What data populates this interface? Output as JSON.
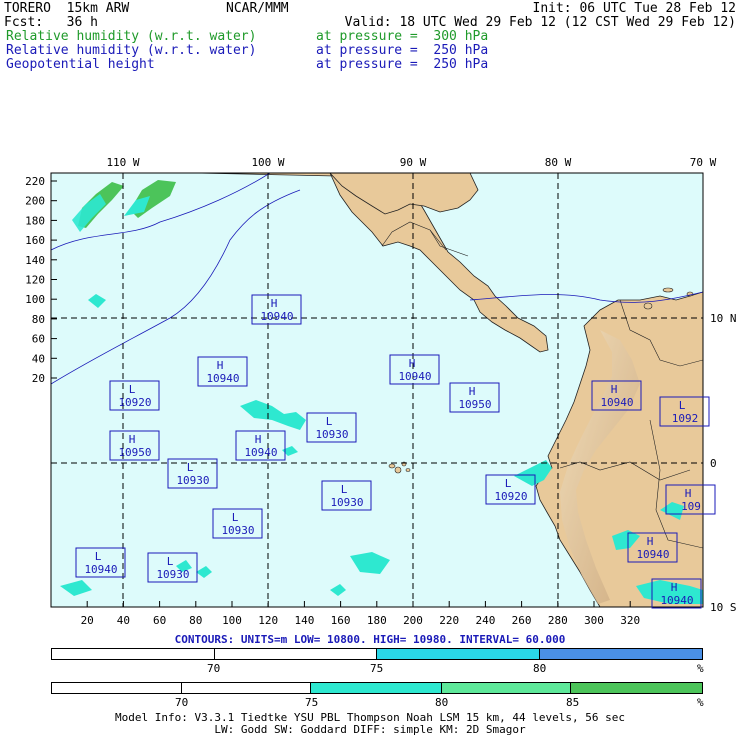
{
  "header": {
    "model": "TORERO  15km ARW",
    "center": "NCAR/MMM",
    "init": "Init: 06 UTC Tue 28 Feb 12",
    "fcst": "Fcst:   36 h",
    "valid": "Valid: 18 UTC Wed 29 Feb 12 (12 CST Wed 29 Feb 12)",
    "fields": [
      {
        "name": "Relative humidity (w.r.t. water)",
        "level": "at pressure =  300 hPa",
        "color": "#1f9a2a"
      },
      {
        "name": "Relative humidity (w.r.t. water)",
        "level": "at pressure =  250 hPa",
        "color": "#1a1ab8"
      },
      {
        "name": "Geopotential height",
        "level": "at pressure =  250 hPa",
        "color": "#1a1ab8"
      }
    ]
  },
  "map": {
    "lon_labels": [
      "110 W",
      "100 W",
      "90 W",
      "80 W",
      "70 W"
    ],
    "lat_labels": [
      "10 N",
      "0",
      "10 S"
    ],
    "x_ticks": [
      "20",
      "40",
      "60",
      "80",
      "100",
      "120",
      "140",
      "160",
      "180",
      "200",
      "220",
      "240",
      "260",
      "280",
      "300",
      "320"
    ],
    "y_ticks": [
      "220",
      "200",
      "180",
      "160",
      "140",
      "120",
      "100",
      "80",
      "60",
      "40",
      "20"
    ],
    "centers": [
      {
        "type": "H",
        "value": "10940"
      },
      {
        "type": "H",
        "value": "10940"
      },
      {
        "type": "H",
        "value": "10940"
      },
      {
        "type": "H",
        "value": "10950"
      },
      {
        "type": "H",
        "value": "10940"
      },
      {
        "type": "H",
        "value": "10950"
      },
      {
        "type": "H",
        "value": "10940"
      },
      {
        "type": "H",
        "value": "10940"
      },
      {
        "type": "L",
        "value": "10920"
      },
      {
        "type": "L",
        "value": "10930"
      },
      {
        "type": "L",
        "value": "10930"
      },
      {
        "type": "L",
        "value": "10930"
      },
      {
        "type": "L",
        "value": "10930"
      },
      {
        "type": "L",
        "value": "10920"
      },
      {
        "type": "L",
        "value": "10940"
      },
      {
        "type": "L",
        "value": "10930"
      },
      {
        "type": "L",
        "value": "1092"
      },
      {
        "type": "H",
        "value": "109"
      },
      {
        "type": "H",
        "value": "10940"
      }
    ],
    "ocean_color": "#ddfbfb",
    "land_color": "#e8c99a"
  },
  "contours_line": "CONTOURS:  UNITS=m  LOW=  10800.     HIGH=  10980.     INTERVAL=   60.000",
  "colorbar1": {
    "labels": [
      "70",
      "75",
      "80",
      "%"
    ],
    "colors": [
      "#ffffff",
      "#ffffff",
      "#2ad7e8",
      "#4a90e6"
    ]
  },
  "colorbar2": {
    "labels": [
      "70",
      "75",
      "80",
      "85",
      "%"
    ],
    "colors": [
      "#ffffff",
      "#ffffff",
      "#2ee8d0",
      "#5ee89a",
      "#4cc45a"
    ]
  },
  "footer": {
    "line1": "Model Info: V3.3.1    Tiedtke YSU PBL  Thompson    Noah LSM  15 km,   44 levels,   56 sec",
    "line2": "LW: Godd SW: Goddard DIFF: simple KM: 2D Smagor"
  }
}
